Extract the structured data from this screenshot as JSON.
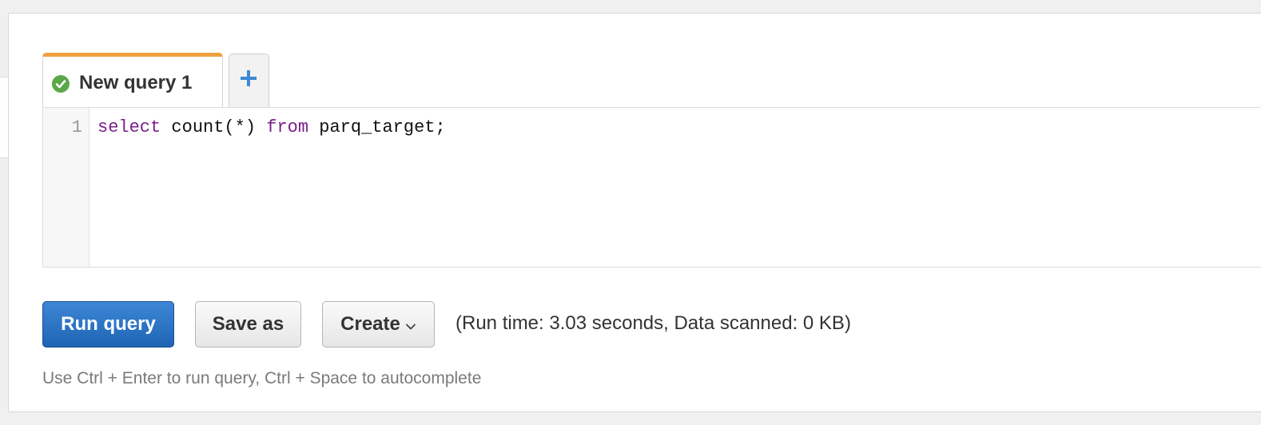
{
  "tabs": [
    {
      "label": "New query 1",
      "status_icon": "check-circle-icon",
      "active": true
    }
  ],
  "add_tab_icon": "plus-icon",
  "editor": {
    "line_number": "1",
    "code_tokens": [
      {
        "text": "select",
        "type": "keyword"
      },
      {
        "text": " count(*) ",
        "type": "plain"
      },
      {
        "text": "from",
        "type": "keyword"
      },
      {
        "text": " parq_target;",
        "type": "plain"
      }
    ]
  },
  "toolbar": {
    "run_label": "Run query",
    "save_label": "Save as",
    "create_label": "Create",
    "create_icon": "chevron-down-icon",
    "run_stats": "(Run time: 3.03 seconds, Data scanned: 0 KB)"
  },
  "hint": "Use Ctrl + Enter to run query, Ctrl + Space to autocomplete",
  "colors": {
    "tab_accent": "#f0a040",
    "primary_button": "#2a72c4",
    "success_icon": "#5aa84a",
    "plus_icon": "#3a8ad4",
    "keyword": "#7a1f8a"
  }
}
